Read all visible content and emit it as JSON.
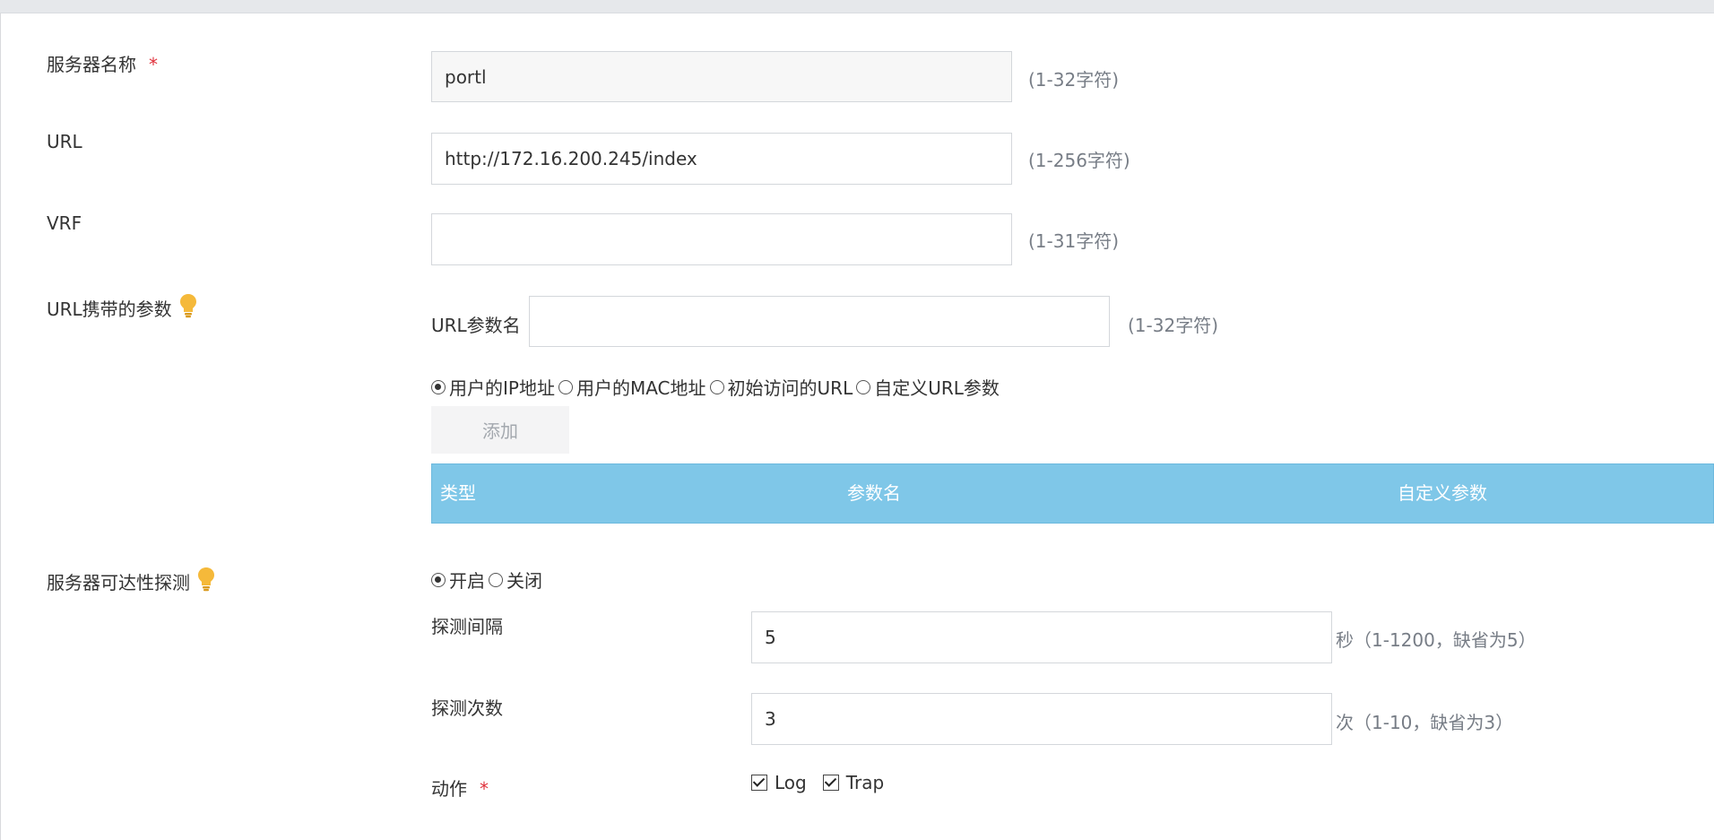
{
  "form": {
    "server_name": {
      "label": "服务器名称",
      "required_mark": "*",
      "value": "portl",
      "hint": "(1-32字符)"
    },
    "url": {
      "label": "URL",
      "value": "http://172.16.200.245/index",
      "hint": "(1-256字符)"
    },
    "vrf": {
      "label": "VRF",
      "value": "",
      "hint": "(1-31字符)"
    },
    "url_params": {
      "label": "URL携带的参数",
      "param_name_label": "URL参数名",
      "param_name_value": "",
      "param_name_hint": "(1-32字符)",
      "options": [
        {
          "label": "用户的IP地址",
          "checked": true
        },
        {
          "label": "用户的MAC地址",
          "checked": false
        },
        {
          "label": "初始访问的URL",
          "checked": false
        },
        {
          "label": "自定义URL参数",
          "checked": false
        }
      ],
      "add_button": "添加",
      "table_headers": [
        "类型",
        "参数名",
        "自定义参数"
      ]
    },
    "reachability": {
      "label": "服务器可达性探测",
      "options": [
        {
          "label": "开启",
          "checked": true
        },
        {
          "label": "关闭",
          "checked": false
        }
      ],
      "interval": {
        "label": "探测间隔",
        "value": "5",
        "hint": "秒（1-1200，缺省为5）"
      },
      "count": {
        "label": "探测次数",
        "value": "3",
        "hint": "次（1-10，缺省为3）"
      },
      "action": {
        "label": "动作",
        "required_mark": "*",
        "checks": [
          {
            "label": "Log",
            "checked": true
          },
          {
            "label": "Trap",
            "checked": true
          }
        ]
      }
    }
  },
  "colors": {
    "table_header_bg": "#7fc7e8",
    "required": "#e0313b",
    "bulb": "#f5b93a"
  }
}
